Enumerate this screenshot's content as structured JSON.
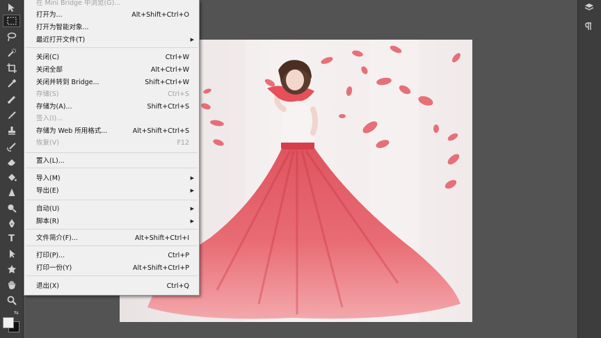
{
  "menu": {
    "items": [
      {
        "label": "在 Mini Bridge 中浏览(G)...",
        "shortcut": "",
        "disabled": true,
        "submenu": false
      },
      {
        "label": "打开为...",
        "shortcut": "Alt+Shift+Ctrl+O",
        "disabled": false,
        "submenu": false
      },
      {
        "label": "打开为智能对象...",
        "shortcut": "",
        "disabled": false,
        "submenu": false
      },
      {
        "label": "最近打开文件(T)",
        "shortcut": "",
        "disabled": false,
        "submenu": true
      },
      {
        "label": "关闭(C)",
        "shortcut": "Ctrl+W",
        "disabled": false,
        "submenu": false
      },
      {
        "label": "关闭全部",
        "shortcut": "Alt+Ctrl+W",
        "disabled": false,
        "submenu": false
      },
      {
        "label": "关闭并转到 Bridge...",
        "shortcut": "Shift+Ctrl+W",
        "disabled": false,
        "submenu": false
      },
      {
        "label": "存储(S)",
        "shortcut": "Ctrl+S",
        "disabled": true,
        "submenu": false
      },
      {
        "label": "存储为(A)...",
        "shortcut": "Shift+Ctrl+S",
        "disabled": false,
        "submenu": false
      },
      {
        "label": "签入(I)...",
        "shortcut": "",
        "disabled": true,
        "submenu": false
      },
      {
        "label": "存储为 Web 所用格式...",
        "shortcut": "Alt+Shift+Ctrl+S",
        "disabled": false,
        "submenu": false
      },
      {
        "label": "恢复(V)",
        "shortcut": "F12",
        "disabled": true,
        "submenu": false
      },
      {
        "label": "置入(L)...",
        "shortcut": "",
        "disabled": false,
        "submenu": false
      },
      {
        "label": "导入(M)",
        "shortcut": "",
        "disabled": false,
        "submenu": true
      },
      {
        "label": "导出(E)",
        "shortcut": "",
        "disabled": false,
        "submenu": true
      },
      {
        "label": "自动(U)",
        "shortcut": "",
        "disabled": false,
        "submenu": true
      },
      {
        "label": "脚本(R)",
        "shortcut": "",
        "disabled": false,
        "submenu": true
      },
      {
        "label": "文件简介(F)...",
        "shortcut": "Alt+Shift+Ctrl+I",
        "disabled": false,
        "submenu": false
      },
      {
        "label": "打印(P)...",
        "shortcut": "Ctrl+P",
        "disabled": false,
        "submenu": false
      },
      {
        "label": "打印一份(Y)",
        "shortcut": "Alt+Shift+Ctrl+P",
        "disabled": false,
        "submenu": false
      },
      {
        "label": "退出(X)",
        "shortcut": "Ctrl+Q",
        "disabled": false,
        "submenu": false
      }
    ]
  },
  "toolbar": {
    "tools": [
      "move-tool",
      "marquee-tool",
      "lasso-tool",
      "quick-select-tool",
      "crop-tool",
      "eyedropper-tool",
      "healing-brush-tool",
      "brush-tool",
      "clone-stamp-tool",
      "history-brush-tool",
      "eraser-tool",
      "gradient-tool",
      "blur-tool",
      "dodge-tool",
      "pen-tool",
      "type-tool",
      "path-select-tool",
      "shape-tool",
      "hand-tool",
      "zoom-tool"
    ],
    "active_tool": "marquee-tool",
    "foreground_color": "#f2f2f2",
    "background_color": "#111111"
  },
  "dock": {
    "icons": [
      "layers-icon",
      "paragraph-icon"
    ]
  },
  "canvas": {
    "image": "woman in red tulle ball gown with falling petals"
  }
}
